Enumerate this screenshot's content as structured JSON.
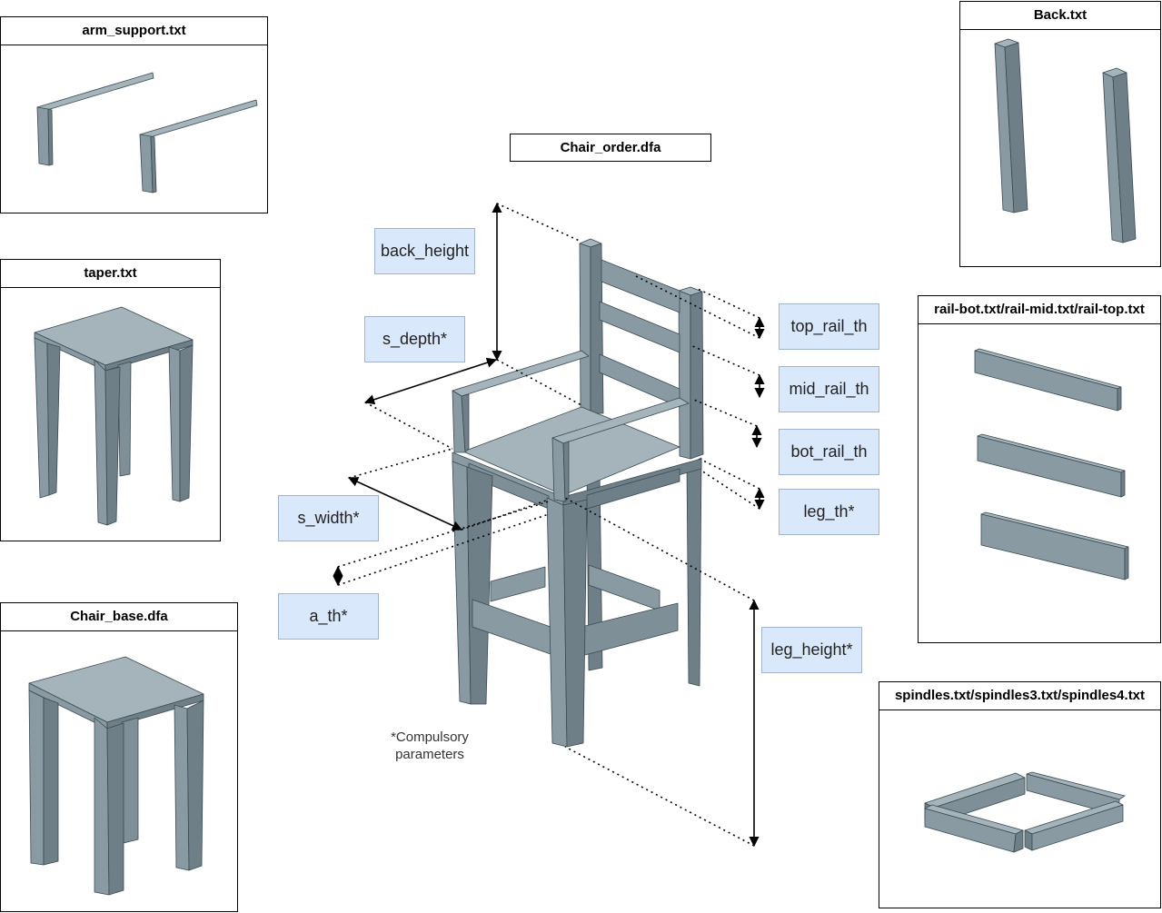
{
  "panels": {
    "arm_support": "arm_support.txt",
    "taper": "taper.txt",
    "chair_base": "Chair_base.dfa",
    "back": "Back.txt",
    "rails": "rail-bot.txt/rail-mid.txt/rail-top.txt",
    "spindles": "spindles.txt/spindles3.txt/spindles4.txt"
  },
  "main_title": "Chair_order.dfa",
  "params": {
    "back_height": "back_height",
    "s_depth": "s_depth*",
    "s_width": "s_width*",
    "a_th": "a_th*",
    "top_rail_th": "top_rail_th",
    "mid_rail_th": "mid_rail_th",
    "bot_rail_th": "bot_rail_th",
    "leg_th": "leg_th*",
    "leg_height": "leg_height*"
  },
  "note": {
    "line1": "*Compulsory",
    "line2": "parameters"
  },
  "colors": {
    "part_top": "#a4b4ba",
    "part_front": "#8a9aa2",
    "part_side": "#6f7f87",
    "param_fill": "#dae8fc"
  }
}
